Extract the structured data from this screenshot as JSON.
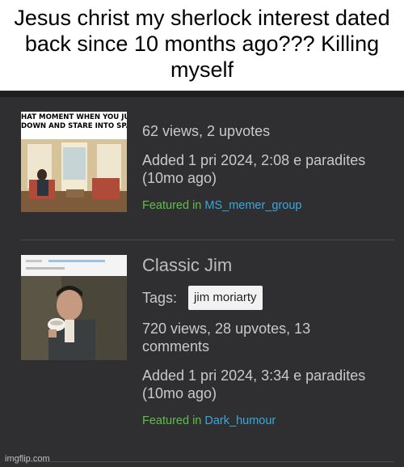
{
  "caption": "Jesus christ my sherlock interest dated back since 10 months ago??? Killing myself",
  "posts": [
    {
      "thumb_caption_line1": "HAT MOMENT WHEN YOU JUS",
      "thumb_caption_line2": "DOWN AND STARE INTO SPA",
      "stats": "62 views, 2 upvotes",
      "added_line1": "Added 1 pri 2024, 2:08 e paradites",
      "added_line2": "(10mo ago)",
      "featured_prefix": "Featured in",
      "featured_link": "MS_memer_group"
    },
    {
      "title": "Classic Jim",
      "tags_label": "Tags:",
      "tag": "jim moriarty",
      "stats_line1": "720 views, 28 upvotes, 13",
      "stats_line2": "comments",
      "added_line1": "Added 1 pri 2024, 3:34 e paradites",
      "added_line2": "(10mo ago)",
      "featured_prefix": "Featured in",
      "featured_link": "Dark_humour"
    }
  ],
  "watermark": "imgflip.com"
}
